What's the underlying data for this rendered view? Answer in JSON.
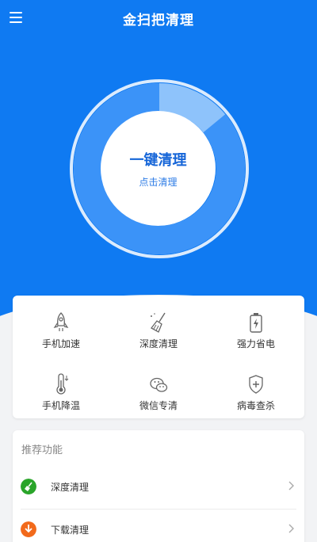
{
  "header": {
    "title": "金扫把清理",
    "menu_icon": "hamburger-icon"
  },
  "hero": {
    "main_label": "一键清理",
    "sub_label": "点击清理",
    "ring_progress": 0.86
  },
  "tools": [
    {
      "label": "手机加速",
      "icon": "rocket-icon"
    },
    {
      "label": "深度清理",
      "icon": "broom-icon"
    },
    {
      "label": "强力省电",
      "icon": "battery-icon"
    },
    {
      "label": "手机降温",
      "icon": "thermometer-icon"
    },
    {
      "label": "微信专清",
      "icon": "wechat-icon"
    },
    {
      "label": "病毒查杀",
      "icon": "shield-icon"
    }
  ],
  "recommended": {
    "heading": "推荐功能",
    "items": [
      {
        "label": "深度清理",
        "icon": "broom-badge-icon",
        "color": "#2aa52a"
      },
      {
        "label": "下载清理",
        "icon": "download-badge-icon",
        "color": "#f26a1b"
      }
    ]
  },
  "colors": {
    "primary": "#0f7af2",
    "ring": "#3b93f8",
    "ring_light": "#8ec3fb"
  }
}
